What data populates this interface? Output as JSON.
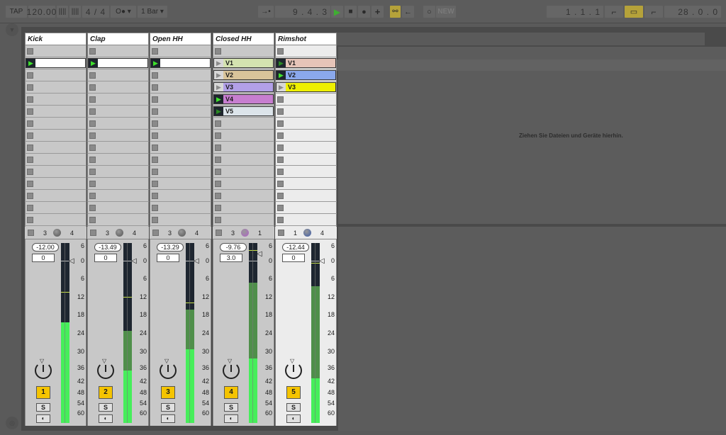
{
  "transport": {
    "tap_label": "TAP",
    "tempo": "120.00",
    "nudge_down": "||||",
    "nudge_up": "||||",
    "time_signature": "4 / 4",
    "metronome": "O●",
    "quantize": "1 Bar",
    "follow_icon": "→•",
    "position": "9 .  4 .  3",
    "loop_start": "1 .  1 .  1",
    "loop_length": "28 .  0 .  0",
    "new_label": "NEW"
  },
  "drop_hint": "Ziehen Sie Dateien und Geräte hierhin.",
  "tracks": [
    {
      "name": "Kick",
      "bg": "#c8c8c8",
      "clips": [
        null,
        {
          "name": "",
          "color": "#ffffff",
          "state": "playing"
        },
        null,
        null,
        null,
        null,
        null,
        null,
        null,
        null,
        null,
        null,
        null,
        null,
        null
      ],
      "sends": [
        "3",
        "4"
      ],
      "dial_color": "#555555",
      "volume": "-12.00",
      "pan": "0",
      "number": "1",
      "solo": "S",
      "meter_level": 0.56,
      "meter_dark": 0,
      "peak": 0.73,
      "scale": [
        "6",
        "0",
        "6",
        "12",
        "18",
        "24",
        "30",
        "36",
        "42",
        "48",
        "54",
        "60"
      ]
    },
    {
      "name": "Clap",
      "bg": "#c8c8c8",
      "clips": [
        null,
        {
          "name": "",
          "color": "#ffffff",
          "state": "playing"
        },
        null,
        null,
        null,
        null,
        null,
        null,
        null,
        null,
        null,
        null,
        null,
        null,
        null
      ],
      "sends": [
        "3",
        "4"
      ],
      "dial_color": "#555555",
      "volume": "-13.49",
      "pan": "0",
      "number": "2",
      "solo": "S",
      "meter_level": 0.29,
      "meter_dark": 0.51,
      "peak": 0.7,
      "scale": [
        "6",
        "0",
        "6",
        "12",
        "18",
        "24",
        "30",
        "36",
        "42",
        "48",
        "54",
        "60"
      ]
    },
    {
      "name": "Open HH",
      "bg": "#c8c8c8",
      "clips": [
        null,
        {
          "name": "",
          "color": "#ffffff",
          "state": "playing"
        },
        null,
        null,
        null,
        null,
        null,
        null,
        null,
        null,
        null,
        null,
        null,
        null,
        null
      ],
      "sends": [
        "3",
        "4"
      ],
      "dial_color": "#555555",
      "volume": "-13.29",
      "pan": "0",
      "number": "3",
      "solo": "S",
      "meter_level": 0.41,
      "meter_dark": 0.63,
      "peak": 0.67,
      "scale": [
        "6",
        "0",
        "6",
        "12",
        "18",
        "24",
        "30",
        "36",
        "42",
        "48",
        "54",
        "60"
      ]
    },
    {
      "name": "Closed HH",
      "bg": "#c8c8c8",
      "clips": [
        null,
        {
          "name": "V1",
          "color": "#d4e3b0",
          "state": "stopped"
        },
        {
          "name": "V2",
          "color": "#d8c49a",
          "state": "stopped"
        },
        {
          "name": "V3",
          "color": "#b2a0e8",
          "state": "stopped"
        },
        {
          "name": "V4",
          "color": "#c77ed0",
          "state": "playing"
        },
        {
          "name": "V5",
          "color": "#dce4ea",
          "state": "queued"
        },
        null,
        null,
        null,
        null,
        null,
        null,
        null,
        null,
        null
      ],
      "sends": [
        "3",
        "1"
      ],
      "dial_color": "#b060c8",
      "volume": "-9.76",
      "pan": "3.0",
      "number": "4",
      "solo": "S",
      "meter_level": 0.36,
      "meter_dark": 0.78,
      "peak": 0.96,
      "scale": [
        "6",
        "0",
        "6",
        "12",
        "18",
        "24",
        "30",
        "36",
        "42",
        "48",
        "54",
        "60"
      ]
    },
    {
      "name": "Rimshot",
      "bg": "#ececec",
      "clips": [
        null,
        {
          "name": "V1",
          "color": "#e6c4b8",
          "state": "queued"
        },
        {
          "name": "V2",
          "color": "#8aa8ec",
          "state": "playing"
        },
        {
          "name": "V3",
          "color": "#eef000",
          "state": "stopped"
        },
        null,
        null,
        null,
        null,
        null,
        null,
        null,
        null,
        null,
        null,
        null
      ],
      "sends": [
        "1",
        "4"
      ],
      "dial_color": "#3b5ba8",
      "volume": "-12.44",
      "pan": "0",
      "number": "5",
      "solo": "S",
      "meter_level": 0.25,
      "meter_dark": 0.76,
      "peak": 0.89,
      "scale": [
        "6",
        "0",
        "6",
        "12",
        "18",
        "24",
        "30",
        "36",
        "42",
        "48",
        "54",
        "60"
      ]
    }
  ]
}
